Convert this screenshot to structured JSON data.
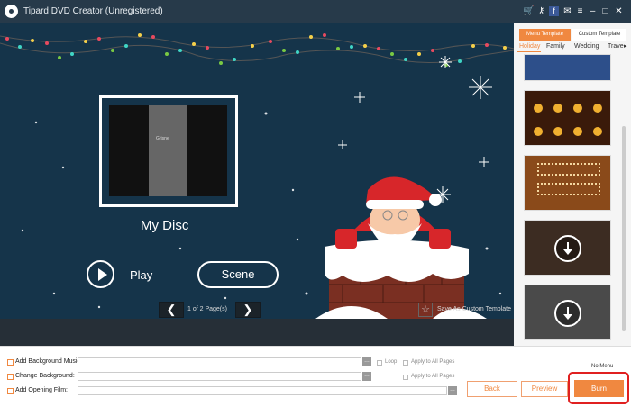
{
  "window": {
    "title": "Tipard DVD Creator (Unregistered)",
    "controls": [
      "cart-icon",
      "key-icon",
      "facebook-icon",
      "feedback-icon",
      "menu-icon",
      "minimize-icon",
      "maximize-icon",
      "close-icon"
    ]
  },
  "preview": {
    "disc_title": "My Disc",
    "thumb_caption": "Grisne",
    "play_label": "Play",
    "scene_label": "Scene"
  },
  "pager": {
    "page_text": "1 of 2 Page(s)",
    "prev_symbol": "❮",
    "next_symbol": "❯",
    "save_custom": "Save As Custom Template"
  },
  "right_panel": {
    "tab_menu": "Menu Template",
    "tab_custom": "Custom Template",
    "categories": [
      "Holiday",
      "Family",
      "Wedding",
      "Trave"
    ]
  },
  "options": {
    "bg_music": "Add Background Music:",
    "change_bg": "Change Background:",
    "opening_film": "Add Opening Film:",
    "loop": "Loop",
    "apply_all": "Apply to All Pages",
    "no_menu": "No Menu"
  },
  "actions": {
    "back": "Back",
    "preview": "Preview",
    "burn": "Burn"
  },
  "colors": {
    "accent": "#f08840",
    "titlebar": "#273a4a",
    "canvas": "#15344a",
    "highlight": "#e02020"
  }
}
